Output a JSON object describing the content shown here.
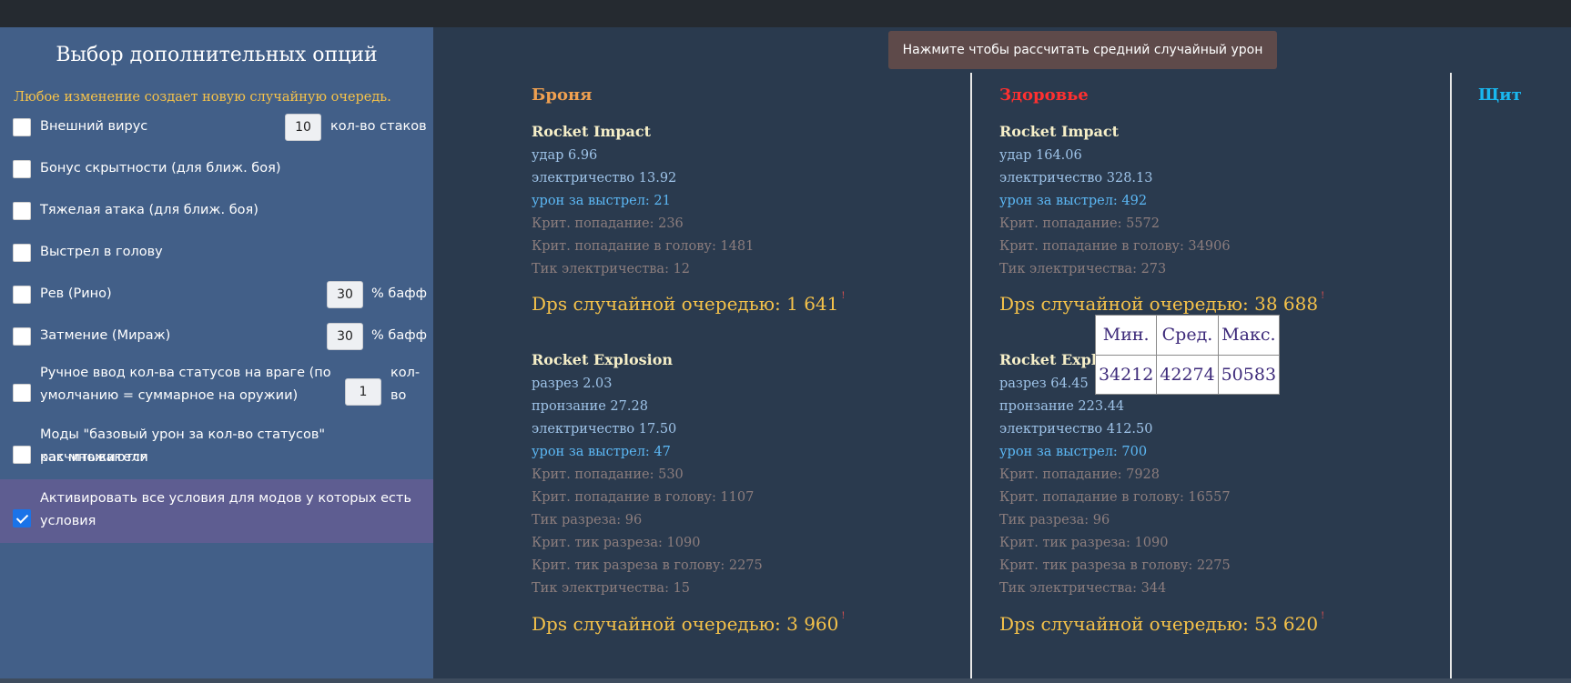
{
  "sidebar": {
    "title": "Выбор дополнительных опций",
    "note": "Любое изменение создает новую случайную очередь.",
    "options": [
      {
        "label": "Внешний вирус",
        "checked": false,
        "value": "10",
        "unit": "кол-во стаков"
      },
      {
        "label": "Бонус скрытности (для ближ. боя)",
        "checked": false
      },
      {
        "label": "Тяжелая атака (для ближ. боя)",
        "checked": false
      },
      {
        "label": "Выстрел в голову",
        "checked": false
      },
      {
        "label": "Рев (Рино)",
        "checked": false,
        "value": "30",
        "unit": "% бафф"
      },
      {
        "label": "Затмение (Мираж)",
        "checked": false,
        "value": "30",
        "unit": "% бафф"
      },
      {
        "label_line1": "Ручное ввод кол-ва статусов на враге (по",
        "label_line2": "умолчанию = суммарное на оружии)",
        "checked": false,
        "value": "1",
        "unit_line1": "кол-",
        "unit_line2": "во"
      },
      {
        "label_line1": "Моды \"базовый урон за кол-во статусов\" расчитываются",
        "label_line2": "как множители",
        "checked": false
      },
      {
        "label_line1": "Активировать все условия для модов у которых есть",
        "label_line2": "условия",
        "checked": true
      }
    ]
  },
  "calc_button": "Нажмите чтобы рассчитать средний случайный урон",
  "columns": {
    "armor": {
      "header": "Броня",
      "impact": {
        "title": "Rocket Impact",
        "lines": [
          "удар 6.96",
          "электричество 13.92",
          "урон за выстрел: 21",
          "Крит. попадание: 236",
          "Крит. попадание в голову: 1481",
          "Тик электричества: 12"
        ],
        "dps": "Dps случайной очередью: 1 641",
        "mark": "!"
      },
      "explosion": {
        "title": "Rocket Explosion",
        "lines": [
          "разрез 2.03",
          "пронзание 27.28",
          "электричество 17.50",
          "урон за выстрел: 47",
          "Крит. попадание: 530",
          "Крит. попадание в голову: 1107",
          "Тик разреза: 96",
          "Крит. тик разреза: 1090",
          "Крит. тик разреза в голову: 2275",
          "Тик электричества: 15"
        ],
        "dps": "Dps случайной очередью: 3 960",
        "mark": "!"
      }
    },
    "health": {
      "header": "Здоровье",
      "impact": {
        "title": "Rocket Impact",
        "lines": [
          "удар 164.06",
          "электричество 328.13",
          "урон за выстрел: 492",
          "Крит. попадание: 5572",
          "Крит. попадание в голову: 34906",
          "Тик электричества: 273"
        ],
        "dps": "Dps случайной очередью: 38 688",
        "mark": "!"
      },
      "explosion": {
        "title": "Rocket Explosion",
        "lines": [
          "разрез 64.45",
          "пронзание 223.44",
          "электричество 412.50",
          "урон за выстрел: 700",
          "Крит. попадание: 7928",
          "Крит. попадание в голову: 16557",
          "Тик разреза: 96",
          "Крит. тик разреза: 1090",
          "Крит. тик разреза в голову: 2275",
          "Тик электричества: 344"
        ],
        "dps": "Dps случайной очередью: 53 620",
        "mark": "!"
      }
    },
    "shield": {
      "header": "Щит"
    }
  },
  "popup": {
    "headers": [
      "Мин.",
      "Сред.",
      "Макс."
    ],
    "values": [
      "34212",
      "42274",
      "50583"
    ]
  },
  "colors": {
    "background": "#2a3a4e",
    "sidebar": "#425f88",
    "armor_header": "#f0a050",
    "health_header": "#ff3030",
    "shield_header": "#19b8f0",
    "dps": "#f5c24a"
  }
}
